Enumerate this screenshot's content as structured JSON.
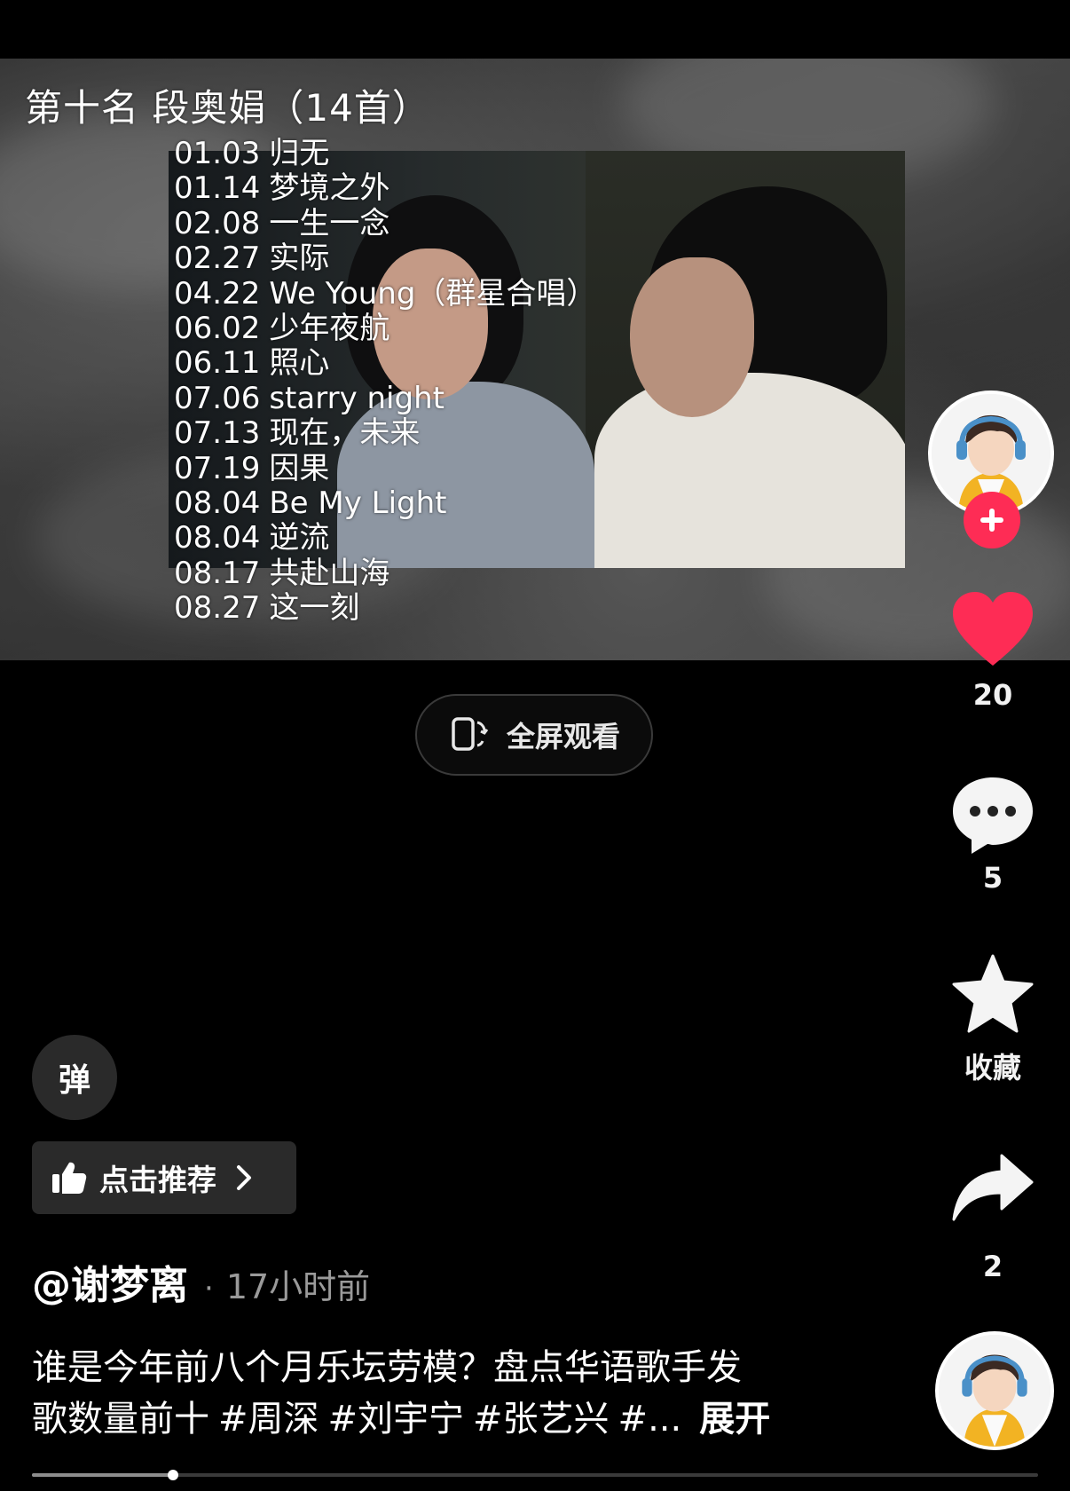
{
  "video": {
    "title": "第十名 段奥娟（14首）",
    "songs": [
      {
        "date": "01.03",
        "name": "归无"
      },
      {
        "date": "01.14",
        "name": "梦境之外"
      },
      {
        "date": "02.08",
        "name": "一生一念"
      },
      {
        "date": "02.27",
        "name": "实际"
      },
      {
        "date": "04.22",
        "name": "We Young（群星合唱）"
      },
      {
        "date": "06.02",
        "name": "少年夜航"
      },
      {
        "date": "06.11",
        "name": "照心"
      },
      {
        "date": "07.06",
        "name": "starry night"
      },
      {
        "date": "07.13",
        "name": "现在，未来"
      },
      {
        "date": "07.19",
        "name": "因果"
      },
      {
        "date": "08.04",
        "name": "Be My Light"
      },
      {
        "date": "08.04",
        "name": "逆流"
      },
      {
        "date": "08.17",
        "name": "共赴山海"
      },
      {
        "date": "08.27",
        "name": "这一刻"
      }
    ]
  },
  "fullscreen": {
    "label": "全屏观看",
    "icon": "rotate-phone-icon"
  },
  "rail": {
    "avatar_icon": "avatar",
    "follow_icon": "plus-icon",
    "like": {
      "icon": "heart-icon",
      "count": "20",
      "color": "#fe2c55"
    },
    "comment": {
      "icon": "comment-icon",
      "count": "5"
    },
    "favorite": {
      "icon": "star-icon",
      "label": "收藏"
    },
    "share": {
      "icon": "share-icon",
      "count": "2"
    }
  },
  "danmaku": {
    "label": "弹"
  },
  "recommend": {
    "label": "点击推荐",
    "icon": "thumbs-up-icon",
    "chevron": "chevron-right-icon"
  },
  "post": {
    "author": "@谢梦离",
    "dot": "·",
    "time": "17小时前",
    "caption_line1": "谁是今年前八个月乐坛劳模？盘点华语歌手发",
    "caption_line2_text": "歌数量前十",
    "tags": [
      "#周深",
      "#刘宇宁",
      "#张艺兴",
      "#..."
    ],
    "expand": "展开"
  },
  "progress": {
    "fraction": 0.14
  },
  "colors": {
    "accent": "#fe2c55",
    "background": "#000000"
  }
}
